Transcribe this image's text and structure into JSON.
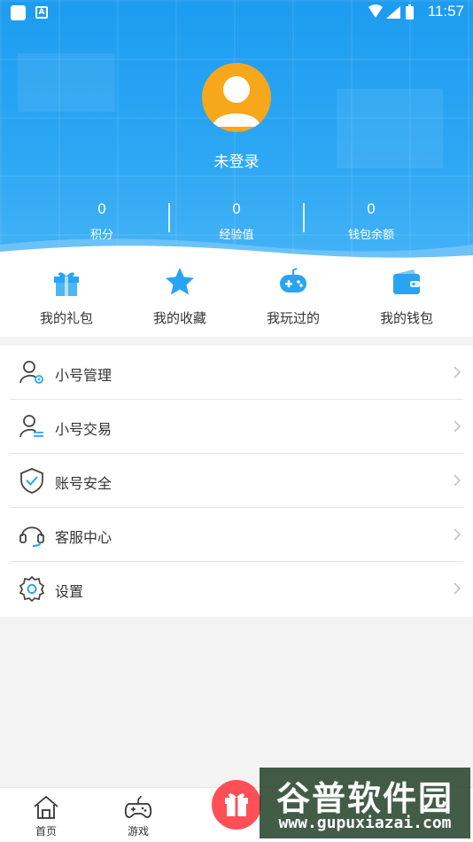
{
  "status_bar": {
    "time": "11:57",
    "indicator_a": "A"
  },
  "profile": {
    "username": "未登录"
  },
  "stats": [
    {
      "value": "0",
      "label": "积分"
    },
    {
      "value": "0",
      "label": "经验值"
    },
    {
      "value": "0",
      "label": "钱包余额"
    }
  ],
  "quick_actions": [
    {
      "label": "我的礼包",
      "icon": "gift-icon"
    },
    {
      "label": "我的收藏",
      "icon": "star-icon"
    },
    {
      "label": "我玩过的",
      "icon": "gamepad-icon"
    },
    {
      "label": "我的钱包",
      "icon": "wallet-icon"
    }
  ],
  "menu": [
    {
      "label": "小号管理",
      "icon": "user-gear-icon"
    },
    {
      "label": "小号交易",
      "icon": "user-transfer-icon"
    },
    {
      "label": "账号安全",
      "icon": "shield-check-icon"
    },
    {
      "label": "客服中心",
      "icon": "headset-icon"
    },
    {
      "label": "设置",
      "icon": "settings-gear-icon"
    }
  ],
  "tabs": [
    {
      "label": "首页",
      "icon": "home-icon"
    },
    {
      "label": "游戏",
      "icon": "gamepad-outline-icon"
    }
  ],
  "watermark": {
    "brand": "谷普软件园",
    "url": "www.gupuxiazai.com"
  },
  "colors": {
    "header_blue": "#1d9cf0",
    "accent_blue": "#29a4f2",
    "avatar_orange": "#f7a71b",
    "gift_red": "#ff4f57"
  }
}
